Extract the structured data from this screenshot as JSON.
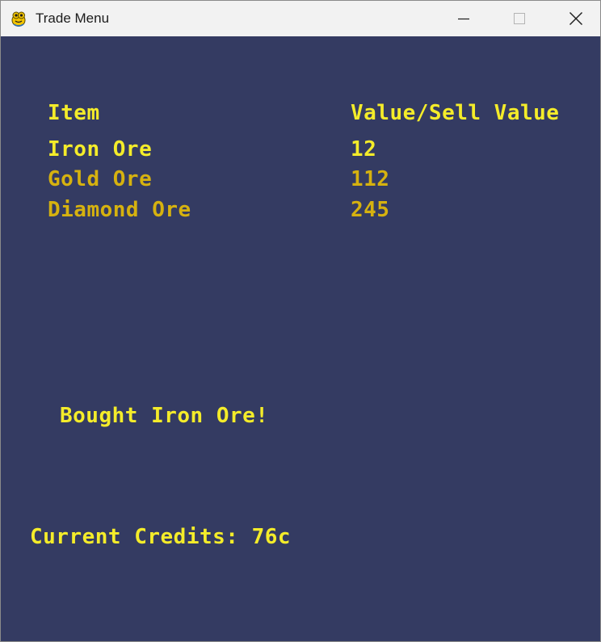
{
  "window": {
    "title": "Trade Menu",
    "app_icon": "pygame-snake-icon",
    "controls": [
      "minimize-icon",
      "maximize-icon",
      "close-icon"
    ]
  },
  "colors": {
    "background": "#343b62",
    "header_text": "#f4ec2a",
    "selected_row": "#f4ec2a",
    "unselected_row": "#d6b20f"
  },
  "table": {
    "headers": {
      "item": "Item",
      "value": "Value/Sell Value"
    },
    "rows": [
      {
        "name": "Iron Ore",
        "value": "12",
        "selected": true
      },
      {
        "name": "Gold Ore",
        "value": "112",
        "selected": false
      },
      {
        "name": "Diamond Ore",
        "value": "245",
        "selected": false
      }
    ]
  },
  "status": {
    "message": "Bought Iron Ore!"
  },
  "credits": {
    "text": "Current Credits: 76c"
  }
}
